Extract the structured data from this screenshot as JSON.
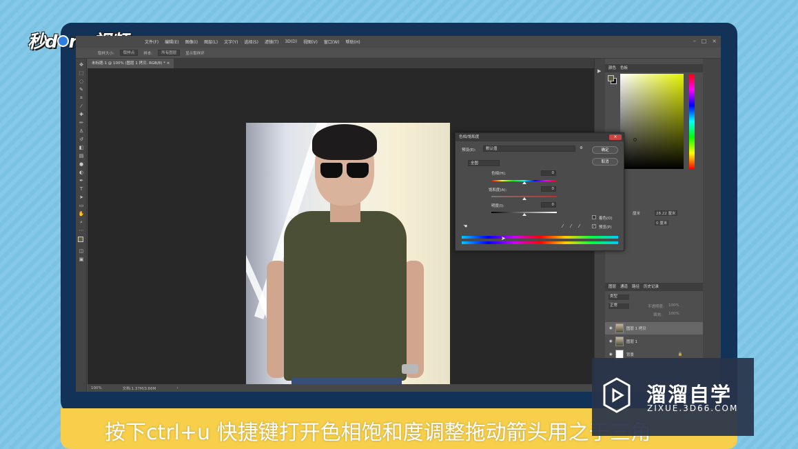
{
  "logo": {
    "text_prefix": "秒d",
    "text_suffix": "ng视频"
  },
  "app": {
    "menu": [
      "文件(F)",
      "编辑(E)",
      "图像(I)",
      "图层(L)",
      "文字(Y)",
      "选择(S)",
      "滤镜(T)",
      "3D(D)",
      "视图(V)",
      "窗口(W)",
      "帮助(H)"
    ],
    "options": {
      "sample_size_label": "取样大小:",
      "sample_size_value": "取样点",
      "sample_label": "样本:",
      "sample_value": "所有图层",
      "ring_label": "显示取样环"
    },
    "doc_tab": "未标题-1 @ 100% (图层 1 拷贝, RGB/8) *",
    "status": {
      "zoom": "100%",
      "doc": "文档:1.37M/3.66M"
    }
  },
  "dialog": {
    "title": "色相/饱和度",
    "preset_label": "预设(E):",
    "preset_value": "默认值",
    "channel_value": "全图",
    "hue_label": "色相(H):",
    "hue_value": "0",
    "hue_position": 0.5,
    "saturation_label": "饱和度(A):",
    "saturation_value": "0",
    "saturation_position": 0.5,
    "lightness_label": "明度(I):",
    "lightness_value": "0",
    "lightness_position": 0.5,
    "ok_label": "确定",
    "cancel_label": "取消",
    "colorize_label": "着色(O)",
    "colorize_checked": false,
    "preview_label": "预览(P)",
    "preview_checked": true
  },
  "panels": {
    "color_tabs": [
      "颜色",
      "色板"
    ],
    "properties": {
      "w_unit": "厘米",
      "h_value": "28.22 厘米",
      "y_value": "0 厘米"
    },
    "layer_tabs": [
      "图层",
      "通道",
      "路径",
      "历史记录"
    ],
    "blend_mode": "正常",
    "opacity_label": "不透明度:",
    "opacity_value": "100%",
    "fill_label": "填充:",
    "fill_value": "100%",
    "kind_label": "类型",
    "layers": [
      {
        "name": "图层 1 拷贝",
        "selected": true
      },
      {
        "name": "图层 1",
        "selected": false
      },
      {
        "name": "背景",
        "selected": false,
        "locked": true
      }
    ]
  },
  "caption": "按下ctrl+u 快捷键打开色相饱和度调整拖动箭头用之于三角",
  "watermark": {
    "title": "溜溜自学",
    "subtitle": "ZIXUE.3D66.COM"
  },
  "colors": {
    "caption_bg": "#f7cf4a",
    "frame": "#123257",
    "background": "#7cc2e3"
  }
}
